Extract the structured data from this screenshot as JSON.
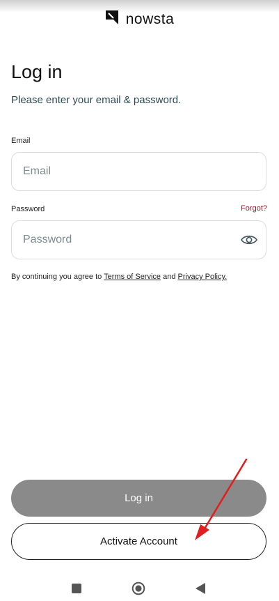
{
  "brand": {
    "name": "nowsta"
  },
  "page": {
    "title": "Log in",
    "subtitle": "Please enter your email & password."
  },
  "form": {
    "email_label": "Email",
    "email_placeholder": "Email",
    "email_value": "",
    "password_label": "Password",
    "password_placeholder": "Password",
    "password_value": "",
    "forgot_label": "Forgot?"
  },
  "terms": {
    "prefix": "By continuing you agree to ",
    "terms_link": "Terms of Service",
    "middle": " and ",
    "privacy_link": "Privacy Policy."
  },
  "actions": {
    "login_label": "Log in",
    "activate_label": "Activate Account"
  },
  "icons": {
    "brand": "nowsta-logo-icon",
    "password_toggle": "eye-icon",
    "annotation": "red-arrow-icon",
    "nav_recents": "square-icon",
    "nav_home": "circle-icon",
    "nav_back": "triangle-back-icon"
  },
  "colors": {
    "accent_link": "#a3132a",
    "login_button_bg": "#8a8a8a",
    "subtitle_text": "#2a4a55",
    "annotation_arrow": "#e02020"
  }
}
